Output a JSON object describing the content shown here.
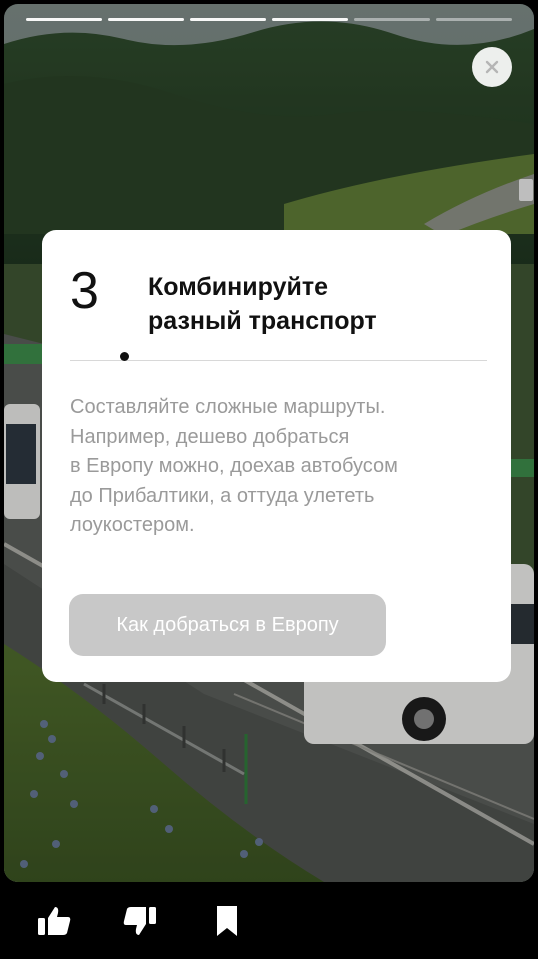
{
  "progress": {
    "total": 6,
    "completed": 4
  },
  "step": {
    "number": "3",
    "title_line1": "Комбинируйте",
    "title_line2": "разный транспорт",
    "description_lines": [
      "Составляйте сложные маршруты.",
      "Например, дешево добраться",
      "в Европу можно, доехав автобусом",
      "до Прибалтики, а оттуда улететь",
      "лоукостером."
    ],
    "cta_label": "Как добраться в Европу"
  },
  "icons": {
    "close": "close-icon",
    "like": "thumbs-up-icon",
    "dislike": "thumbs-down-icon",
    "bookmark": "bookmark-icon"
  },
  "colors": {
    "card_bg": "#ffffff",
    "cta_bg": "#c8c8c8",
    "description_text": "#9a9a9a",
    "bottom_bar_bg": "#000000"
  }
}
